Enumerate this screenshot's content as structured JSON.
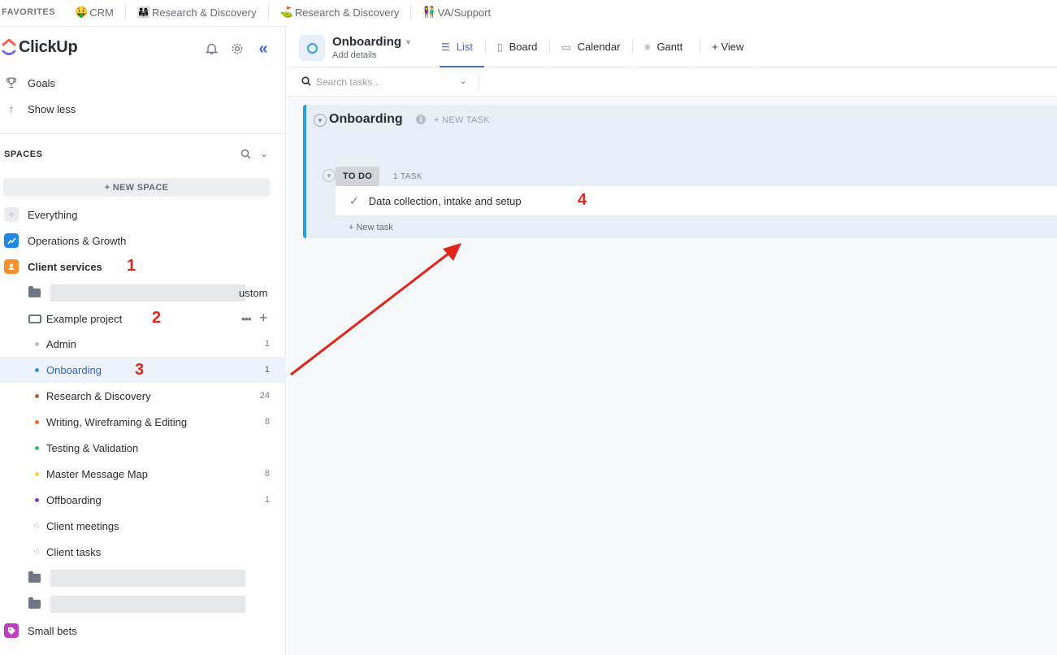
{
  "favorites": {
    "title": "FAVORITES",
    "items": [
      {
        "emoji": "🤑",
        "label": "CRM"
      },
      {
        "emoji": "👨‍👩‍👧",
        "label": "Research & Discovery"
      },
      {
        "emoji": "⛳",
        "label": "Research & Discovery"
      },
      {
        "emoji": "👫",
        "label": "VA/Support"
      }
    ]
  },
  "sidebar": {
    "logo_text": "ClickUp",
    "goals_label": "Goals",
    "show_less_label": "Show less",
    "spaces_header": "SPACES",
    "new_space_label": "+ NEW SPACE",
    "everything_label": "Everything",
    "spaces": [
      {
        "label": "Operations & Growth",
        "color": "#1e88e5"
      },
      {
        "label": "Client services",
        "color": "#f7902d"
      },
      {
        "label": "Small bets",
        "color": "#c13ec1"
      }
    ],
    "folder_partial_text": "ustom",
    "folder_example": "Example project",
    "lists": [
      {
        "label": "Admin",
        "count": "1",
        "color": "#b9bec7"
      },
      {
        "label": "Onboarding",
        "count": "1",
        "color": "#2a9ed6"
      },
      {
        "label": "Research & Discovery",
        "count": "24",
        "color": "#b1612a"
      },
      {
        "label": "Writing, Wireframing & Editing",
        "count": "8",
        "color": "#f26b21"
      },
      {
        "label": "Testing & Validation",
        "count": "",
        "color": "#2dbe60"
      },
      {
        "label": "Master Message Map",
        "count": "8",
        "color": "#f9d23c"
      },
      {
        "label": "Offboarding",
        "count": "1",
        "color": "#8a3ec1"
      },
      {
        "label": "Client meetings",
        "count": "",
        "color": ""
      },
      {
        "label": "Client tasks",
        "count": "",
        "color": ""
      }
    ]
  },
  "annotations": {
    "n1": "1",
    "n2": "2",
    "n3": "3",
    "n4": "4"
  },
  "main": {
    "title": "Onboarding",
    "subtitle": "Add details",
    "tabs": [
      "List",
      "Board",
      "Calendar",
      "Gantt",
      "+ View"
    ],
    "search_placeholder": "Search tasks...",
    "list_title": "Onboarding",
    "list_new_task": "+ NEW TASK",
    "status_label": "TO DO",
    "task_count": "1 TASK",
    "task_name": "Data collection, intake and setup",
    "new_task_link": "+ New task"
  },
  "colors": {
    "accent": "#4169e1",
    "annotation_red": "#e0261b"
  }
}
